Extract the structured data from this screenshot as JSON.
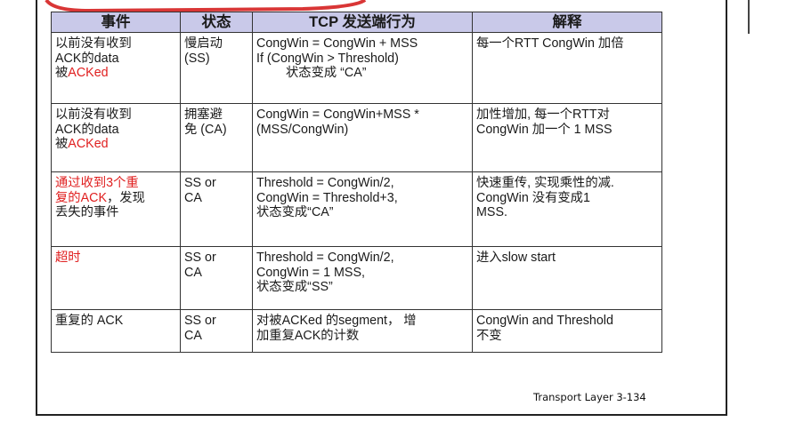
{
  "headers": [
    "事件",
    "状态",
    "TCP 发送端行为",
    "解释"
  ],
  "rows": [
    {
      "event_a": "以前没有收到",
      "event_b": "ACK的data",
      "event_c": "被",
      "event_d": "ACKed",
      "state_a": "慢启动",
      "state_b": "(SS)",
      "action_a": "CongWin = CongWin + MSS",
      "action_b": "If (CongWin > Threshold)",
      "action_c": "状态变成 “CA”",
      "explain_a": "每一个RTT CongWin 加倍"
    },
    {
      "event_a": "以前没有收到",
      "event_b": "ACK的data",
      "event_c": "被",
      "event_d": "ACKed",
      "state_a": "拥塞避",
      "state_b": "免 (CA)",
      "action_a": "CongWin = CongWin+MSS *",
      "action_b": "(MSS/CongWin)",
      "explain_a": "加性增加, 每一个RTT对",
      "explain_b": "CongWin 加一个 1 MSS"
    },
    {
      "event_a1": "通过",
      "event_a2": "收到3个重",
      "event_b1": "复的ACK",
      "event_b2": "，发现",
      "event_c": "丢失的事件",
      "state_a": "SS or",
      "state_b": "CA",
      "action_a": "Threshold = CongWin/2,",
      "action_b": "CongWin = Threshold+3,",
      "action_c": "状态变成“CA”",
      "explain_a": "快速重传, 实现乘性的减.",
      "explain_b": "CongWin 没有变成1",
      "explain_c": "MSS."
    },
    {
      "event_a": "超时",
      "state_a": "SS or",
      "state_b": "CA",
      "action_a": "Threshold = CongWin/2,",
      "action_b": "CongWin = 1 MSS,",
      "action_c": "状态变成“SS”",
      "explain_a": "进入slow start"
    },
    {
      "event_a": "重复的 ACK",
      "state_a": "SS or",
      "state_b": "CA",
      "action_a": "对被ACKed 的segment，  增",
      "action_b": "加重复ACK的计数",
      "explain_a": "CongWin and Threshold",
      "explain_b": "不变"
    }
  ],
  "footer": "Transport Layer  3-134",
  "colors": {
    "header_bg": "#c9c9e9",
    "highlight": "#e02020",
    "swoosh": "#d93636"
  }
}
